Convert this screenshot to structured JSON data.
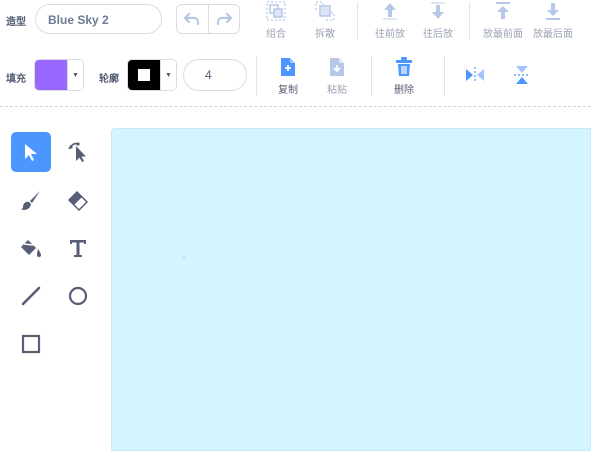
{
  "costume": {
    "label": "造型",
    "name": "Blue Sky 2"
  },
  "toolbar_top": {
    "group": "组合",
    "ungroup": "拆散",
    "forward": "往前放",
    "backward": "往后放",
    "front": "放最前面",
    "back": "放最后面"
  },
  "fill": {
    "label": "填充",
    "color": "#9966ff"
  },
  "outline": {
    "label": "轮廓",
    "color": "#000000",
    "width": "4"
  },
  "toolbar_mid": {
    "copy": "复制",
    "paste": "粘贴",
    "delete": "删除"
  },
  "colors": {
    "accent": "#4c97ff",
    "canvas": "#d4f5ff",
    "text": "#575e75"
  },
  "tools": [
    "select",
    "reshape",
    "brush",
    "eraser",
    "fill",
    "text",
    "line",
    "circle",
    "rectangle"
  ],
  "active_tool": "select"
}
